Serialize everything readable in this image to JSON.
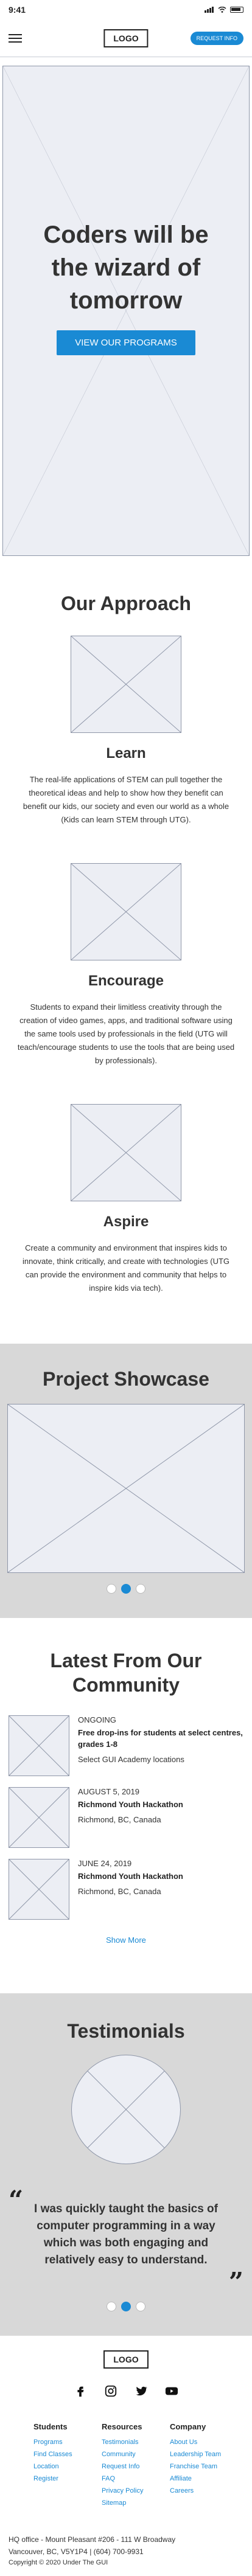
{
  "status_bar": {
    "time": "9:41"
  },
  "nav": {
    "logo": "LOGO",
    "request_info": "REQUEST INFO"
  },
  "hero": {
    "headline": "Coders will be the wizard of tomorrow",
    "cta": "VIEW OUR PROGRAMS"
  },
  "approach": {
    "title": "Our Approach",
    "features": [
      {
        "title": "Learn",
        "text": "The real-life applications of STEM can pull together the theoretical ideas and help to show how they benefit can benefit our kids, our society and even our world as a whole (Kids can learn STEM through UTG)."
      },
      {
        "title": "Encourage",
        "text": "Students to expand their limitless creativity through the creation of video games, apps, and traditional software using the same tools used by professionals in the field (UTG will teach/encourage students to use the tools that are being used by professionals)."
      },
      {
        "title": "Aspire",
        "text": "Create a community and environment that inspires kids to innovate, think critically, and create with technologies (UTG can provide the environment and community that helps to inspire kids via tech)."
      }
    ]
  },
  "showcase": {
    "title": "Project Showcase"
  },
  "news": {
    "title": "Latest From Our Community",
    "items": [
      {
        "date": "ONGOING",
        "title": "Free drop-ins for students at select centres, grades 1-8",
        "location": "Select GUI Academy locations"
      },
      {
        "date": "AUGUST 5, 2019",
        "title": "Richmond Youth Hackathon",
        "location": "Richmond, BC, Canada"
      },
      {
        "date": "JUNE 24, 2019",
        "title": "Richmond Youth Hackathon",
        "location": "Richmond, BC, Canada"
      }
    ],
    "show_more": "Show More"
  },
  "testimonials": {
    "title": "Testimonials",
    "quote": "I was quickly taught the basics of computer programming in a  way which was both engaging and relatively easy to understand.",
    "open_quote": "“",
    "close_quote": "”"
  },
  "footer": {
    "logo": "LOGO",
    "columns": [
      {
        "title": "Students",
        "links": [
          "Programs",
          "Find Classes",
          "Location",
          "Register"
        ]
      },
      {
        "title": "Resources",
        "links": [
          "Testimonials",
          "Community",
          "Request Info",
          "FAQ",
          "Privacy Policy",
          "Sitemap"
        ]
      },
      {
        "title": "Company",
        "links": [
          "About Us",
          "Leadership Team",
          "Franchise Team",
          "Affiliate",
          "Careers"
        ]
      }
    ],
    "office_line1": "HQ office - Mount Pleasant #206 - 111 W Broadway",
    "office_line2": "Vancouver, BC, V5Y1P4 | (604) 700-9931",
    "copyright": "Copyright © 2020 Under The GUI"
  },
  "colors": {
    "accent": "#1a8ad4",
    "band_gray": "#d8d8d8",
    "placeholder": "#eceef4"
  }
}
